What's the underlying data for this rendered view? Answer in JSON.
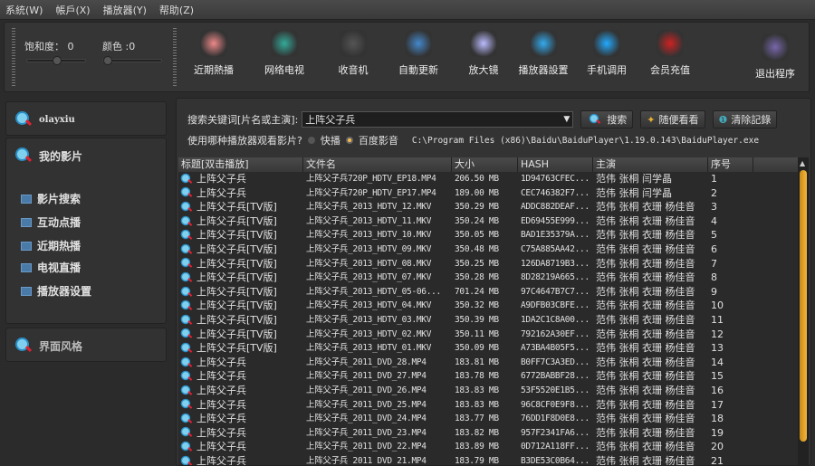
{
  "menu": [
    "系統(W)",
    "帳戶(X)",
    "播放器(Y)",
    "帮助(Z)"
  ],
  "sliders": {
    "saturation_label": "饱和度：",
    "saturation_value": "0",
    "color_label": "颜色 :",
    "color_value": "0",
    "saturation_pct": 50,
    "color_pct": 0
  },
  "toolbar": [
    {
      "label": "近期熱播",
      "icon": "flower-icon",
      "color": "#e88"
    },
    {
      "label": "网络电视",
      "icon": "tv-globe-icon",
      "color": "#3a9"
    },
    {
      "label": "收音机",
      "icon": "headphones-icon",
      "color": "#555"
    },
    {
      "label": "自動更新",
      "icon": "update-icon",
      "color": "#48c"
    },
    {
      "label": "放大镜",
      "icon": "bulb-icon",
      "color": "#bbf"
    },
    {
      "label": "播放器設置",
      "icon": "gears-icon",
      "color": "#3ae"
    },
    {
      "label": "手机调用",
      "icon": "phone-icon",
      "color": "#2af"
    },
    {
      "label": "会员充值",
      "icon": "pinterest-icon",
      "color": "#c22"
    },
    {
      "label": "退出程序",
      "icon": "exit-door-icon",
      "color": "#76a"
    }
  ],
  "sidebar": {
    "user": "olayxiu",
    "section": "我的影片",
    "items": [
      "影片搜索",
      "互动点播",
      "近期热播",
      "电视直播",
      "播放器设置"
    ],
    "theme": "界面风格"
  },
  "search": {
    "label": "搜索关键词[片名或主演]:",
    "value": "上阵父子兵",
    "search_btn": "搜索",
    "random_btn": "随便看看",
    "clear_btn": "清除記錄"
  },
  "player": {
    "label": "使用哪种播放器观看影片?",
    "opt1": "快播",
    "opt2": "百度影音",
    "selected": "百度影音",
    "path": "C:\\Program Files (x86)\\Baidu\\BaiduPlayer\\1.19.0.143\\BaiduPlayer.exe"
  },
  "table": {
    "headers": [
      "标题[双击播放]",
      "文件名",
      "大小",
      "HASH",
      "主演",
      "序号"
    ],
    "rows": [
      [
        "上阵父子兵",
        "上阵父子兵720P_HDTV_EP18.MP4",
        "206.50 MB",
        "1D94763CFEC...",
        "范伟 张桐 闫学晶",
        "1"
      ],
      [
        "上阵父子兵",
        "上阵父子兵720P_HDTV_EP17.MP4",
        "189.00 MB",
        "CEC746382F7...",
        "范伟 张桐 闫学晶",
        "2"
      ],
      [
        "上阵父子兵[TV版]",
        "上阵父子兵_2013_HDTV_12.MKV",
        "350.29 MB",
        "ADDC882DEAF...",
        "范伟 张桐 衣珊 杨佳音",
        "3"
      ],
      [
        "上阵父子兵[TV版]",
        "上阵父子兵_2013_HDTV_11.MKV",
        "350.24 MB",
        "ED69455E999...",
        "范伟 张桐 衣珊 杨佳音",
        "4"
      ],
      [
        "上阵父子兵[TV版]",
        "上阵父子兵_2013_HDTV_10.MKV",
        "350.05 MB",
        "BAD1E35379A...",
        "范伟 张桐 衣珊 杨佳音",
        "5"
      ],
      [
        "上阵父子兵[TV版]",
        "上阵父子兵_2013_HDTV_09.MKV",
        "350.48 MB",
        "C75A885AA42...",
        "范伟 张桐 衣珊 杨佳音",
        "6"
      ],
      [
        "上阵父子兵[TV版]",
        "上阵父子兵_2013_HDTV_08.MKV",
        "350.25 MB",
        "126DA8719B3...",
        "范伟 张桐 衣珊 杨佳音",
        "7"
      ],
      [
        "上阵父子兵[TV版]",
        "上阵父子兵_2013_HDTV_07.MKV",
        "350.28 MB",
        "8D28219A665...",
        "范伟 张桐 衣珊 杨佳音",
        "8"
      ],
      [
        "上阵父子兵[TV版]",
        "上阵父子兵_2013_HDTV_05-06...",
        "701.24 MB",
        "97C4647B7C7...",
        "范伟 张桐 衣珊 杨佳音",
        "9"
      ],
      [
        "上阵父子兵[TV版]",
        "上阵父子兵_2013_HDTV_04.MKV",
        "350.32 MB",
        "A9DFB03CBFE...",
        "范伟 张桐 衣珊 杨佳音",
        "10"
      ],
      [
        "上阵父子兵[TV版]",
        "上阵父子兵_2013_HDTV_03.MKV",
        "350.39 MB",
        "1DA2C1C8A00...",
        "范伟 张桐 衣珊 杨佳音",
        "11"
      ],
      [
        "上阵父子兵[TV版]",
        "上阵父子兵_2013_HDTV_02.MKV",
        "350.11 MB",
        "792162A30EF...",
        "范伟 张桐 衣珊 杨佳音",
        "12"
      ],
      [
        "上阵父子兵[TV版]",
        "上阵父子兵_2013_HDTV_01.MKV",
        "350.09 MB",
        "A73BA4B05F5...",
        "范伟 张桐 衣珊 杨佳音",
        "13"
      ],
      [
        "上阵父子兵",
        "上阵父子兵_2011_DVD_28.MP4",
        "183.81 MB",
        "B0FF7C3A3ED...",
        "范伟 张桐 衣珊 杨佳音",
        "14"
      ],
      [
        "上阵父子兵",
        "上阵父子兵_2011_DVD_27.MP4",
        "183.78 MB",
        "6772BABBF28...",
        "范伟 张桐 衣珊 杨佳音",
        "15"
      ],
      [
        "上阵父子兵",
        "上阵父子兵_2011_DVD_26.MP4",
        "183.83 MB",
        "53F5520E1B5...",
        "范伟 张桐 衣珊 杨佳音",
        "16"
      ],
      [
        "上阵父子兵",
        "上阵父子兵_2011_DVD_25.MP4",
        "183.83 MB",
        "96C8CF0E9F8...",
        "范伟 张桐 衣珊 杨佳音",
        "17"
      ],
      [
        "上阵父子兵",
        "上阵父子兵_2011_DVD_24.MP4",
        "183.77 MB",
        "76DD1F8D0E8...",
        "范伟 张桐 衣珊 杨佳音",
        "18"
      ],
      [
        "上阵父子兵",
        "上阵父子兵_2011_DVD_23.MP4",
        "183.82 MB",
        "957F2341FA6...",
        "范伟 张桐 衣珊 杨佳音",
        "19"
      ],
      [
        "上阵父子兵",
        "上阵父子兵_2011_DVD_22.MP4",
        "183.89 MB",
        "0D712A118FF...",
        "范伟 张桐 衣珊 杨佳音",
        "20"
      ],
      [
        "上阵父子兵",
        "上阵父子兵_2011_DVD_21.MP4",
        "183.79 MB",
        "B3DE53C0B64...",
        "范伟 张桐 衣珊 杨佳音",
        "21"
      ]
    ]
  }
}
